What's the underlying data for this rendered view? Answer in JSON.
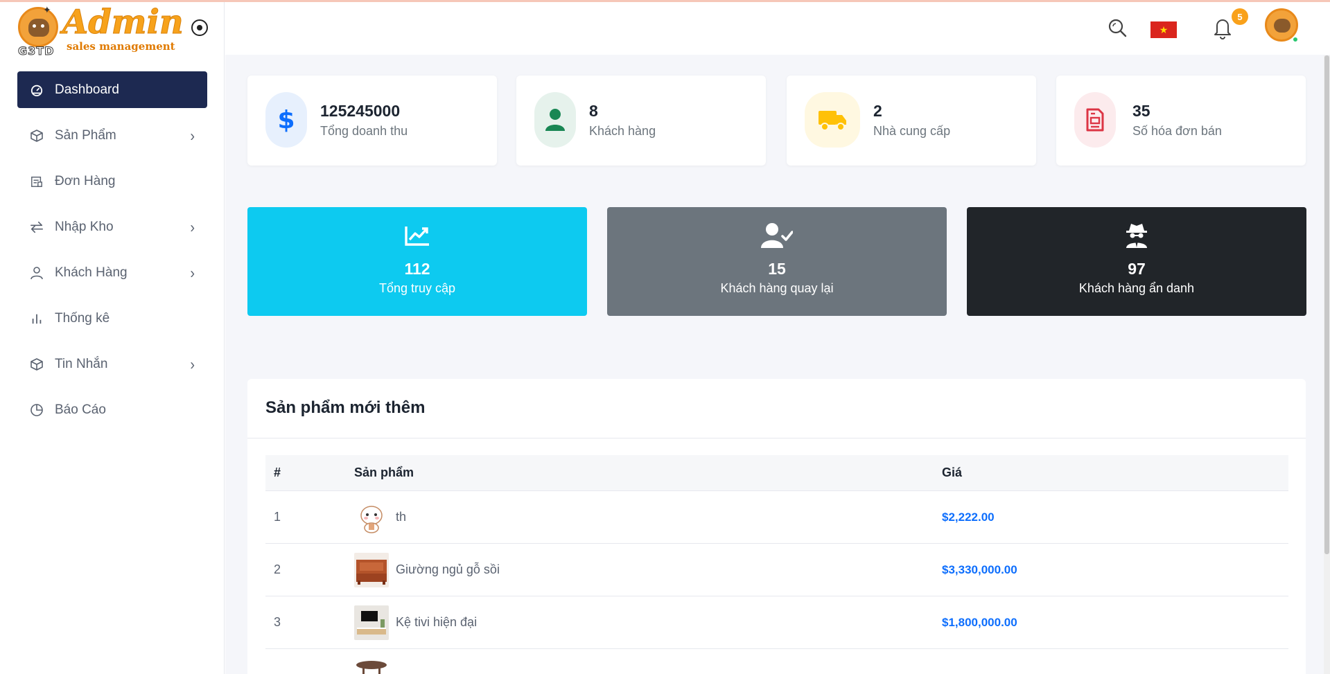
{
  "brand": {
    "title": "Admin",
    "tagline": "sales management",
    "badge_text": "G3TD"
  },
  "header": {
    "notification_count": "5",
    "flag": "vietnam-flag",
    "flag_star": "★"
  },
  "sidebar": {
    "items": [
      {
        "label": "Dashboard",
        "icon": "dashboard-icon",
        "active": true,
        "has_children": false
      },
      {
        "label": "Sản Phẩm",
        "icon": "box-icon",
        "has_children": true
      },
      {
        "label": "Đơn Hàng",
        "icon": "receipt-icon",
        "has_children": false
      },
      {
        "label": "Nhập Kho",
        "icon": "transfer-icon",
        "has_children": true
      },
      {
        "label": "Khách Hàng",
        "icon": "user-icon",
        "has_children": true
      },
      {
        "label": "Thống kê",
        "icon": "bar-chart-icon",
        "has_children": false
      },
      {
        "label": "Tin Nhắn",
        "icon": "box-icon",
        "has_children": true
      },
      {
        "label": "Báo Cáo",
        "icon": "pie-clock-icon",
        "has_children": false
      }
    ],
    "chevron": "›"
  },
  "stats": [
    {
      "value": "125245000",
      "label": "Tổng doanh thu",
      "icon": "dollar-icon",
      "color": "#0d6efd",
      "bg": "#e7f0fd"
    },
    {
      "value": "8",
      "label": "Khách hàng",
      "icon": "person-icon",
      "color": "#198754",
      "bg": "#e6f2ec"
    },
    {
      "value": "2",
      "label": "Nhà cung cấp",
      "icon": "truck-icon",
      "color": "#ffc107",
      "bg": "#fff8e1"
    },
    {
      "value": "35",
      "label": "Số hóa đơn bán",
      "icon": "invoice-icon",
      "color": "#dc3545",
      "bg": "#fcebed"
    }
  ],
  "highlights": [
    {
      "value": "112",
      "label": "Tổng truy cập",
      "icon": "trend-chart-icon",
      "bg": "#0dcaf0"
    },
    {
      "value": "15",
      "label": "Khách hàng quay lại",
      "icon": "user-check-icon",
      "bg": "#6c757d"
    },
    {
      "value": "97",
      "label": "Khách hàng ẩn danh",
      "icon": "user-secret-icon",
      "bg": "#212529"
    }
  ],
  "products_panel": {
    "title": "Sản phẩm mới thêm",
    "columns": [
      "#",
      "Sản phẩm",
      "Giá"
    ],
    "rows": [
      {
        "num": "1",
        "name": "th",
        "price": "$2,222.00",
        "thumb": "cat-sticker-thumb"
      },
      {
        "num": "2",
        "name": "Giường ngủ gỗ sồi",
        "price": "$3,330,000.00",
        "thumb": "bed-thumb"
      },
      {
        "num": "3",
        "name": "Kệ tivi hiện đại",
        "price": "$1,800,000.00",
        "thumb": "tv-stand-thumb"
      }
    ]
  }
}
